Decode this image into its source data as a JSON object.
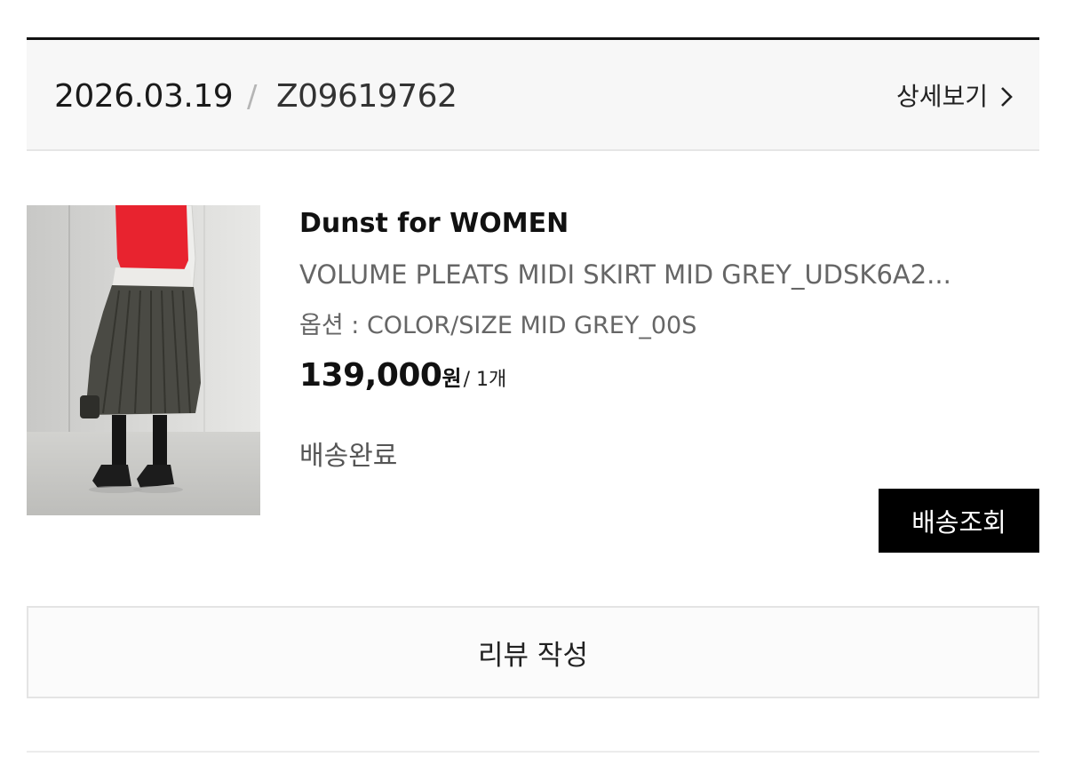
{
  "order": {
    "date": "2026.03.19",
    "separator": "/",
    "number": "Z09619762",
    "detail_label": "상세보기",
    "detail_icon": "chevron-right-icon"
  },
  "product": {
    "image_alt": "volume pleats midi skirt model photo",
    "brand": "Dunst for WOMEN",
    "name": "VOLUME PLEATS MIDI SKIRT MID GREY_UDSK6A2...",
    "option": "옵션 : COLOR/SIZE MID GREY_00S",
    "price": "139,000",
    "currency": "원",
    "quantity": "/ 1개",
    "status": "배송완료",
    "track_label": "배송조회"
  },
  "review": {
    "label": "리뷰 작성"
  },
  "colors": {
    "accent": "#000000",
    "header_bg": "#f7f7f7",
    "top_rule": "#111111",
    "vest": "#e8232f"
  }
}
